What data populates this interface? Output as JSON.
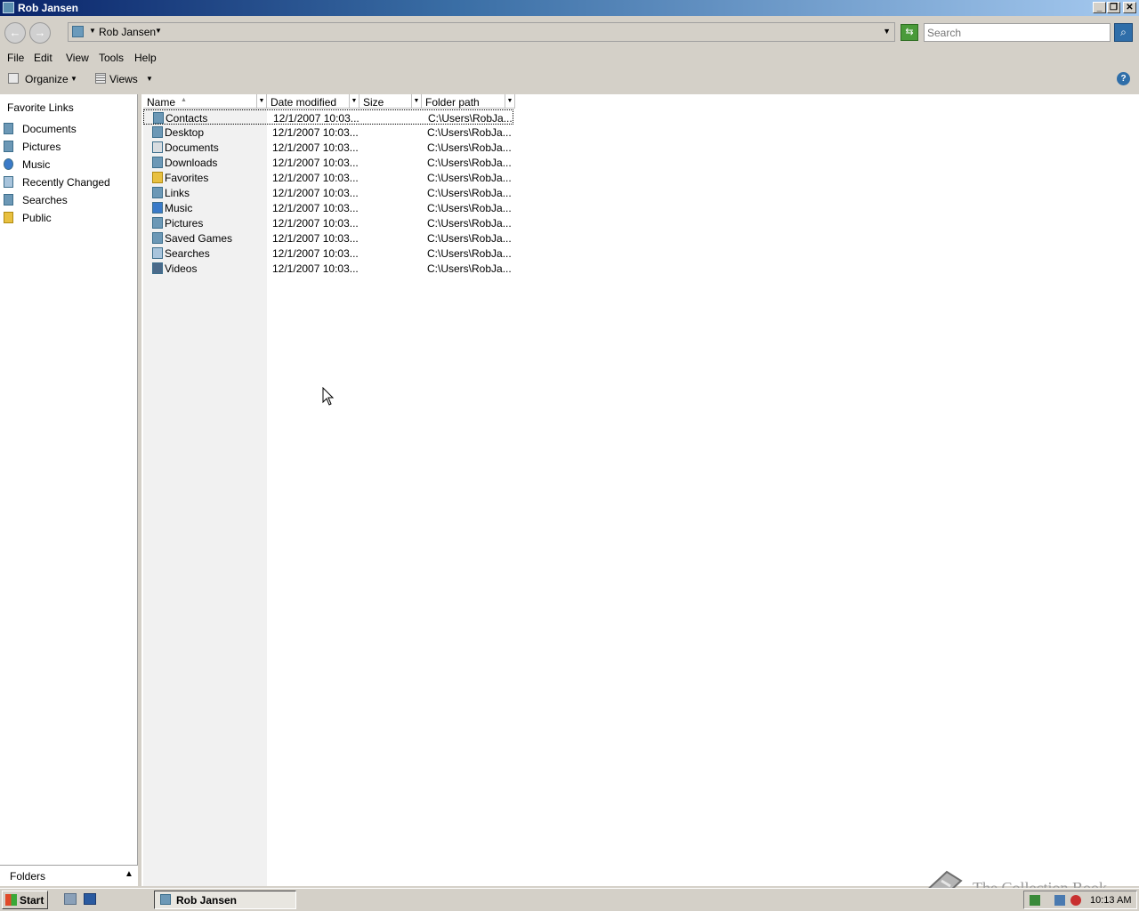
{
  "window": {
    "title": "Rob Jansen"
  },
  "address": {
    "crumb": "Rob Jansen"
  },
  "search": {
    "placeholder": "Search"
  },
  "menu": {
    "file": "File",
    "edit": "Edit",
    "view": "View",
    "tools": "Tools",
    "help": "Help"
  },
  "toolbar": {
    "organize": "Organize",
    "views": "Views"
  },
  "nav": {
    "title": "Favorite Links",
    "links": [
      "Documents",
      "Pictures",
      "Music",
      "Recently Changed",
      "Searches",
      "Public"
    ],
    "folders_label": "Folders"
  },
  "columns": {
    "name": "Name",
    "date": "Date modified",
    "size": "Size",
    "path": "Folder path"
  },
  "files": [
    {
      "name": "Contacts",
      "date": "12/1/2007 10:03...",
      "path": "C:\\Users\\RobJa..."
    },
    {
      "name": "Desktop",
      "date": "12/1/2007 10:03...",
      "path": "C:\\Users\\RobJa..."
    },
    {
      "name": "Documents",
      "date": "12/1/2007 10:03...",
      "path": "C:\\Users\\RobJa..."
    },
    {
      "name": "Downloads",
      "date": "12/1/2007 10:03...",
      "path": "C:\\Users\\RobJa..."
    },
    {
      "name": "Favorites",
      "date": "12/1/2007 10:03...",
      "path": "C:\\Users\\RobJa..."
    },
    {
      "name": "Links",
      "date": "12/1/2007 10:03...",
      "path": "C:\\Users\\RobJa..."
    },
    {
      "name": "Music",
      "date": "12/1/2007 10:03...",
      "path": "C:\\Users\\RobJa..."
    },
    {
      "name": "Pictures",
      "date": "12/1/2007 10:03...",
      "path": "C:\\Users\\RobJa..."
    },
    {
      "name": "Saved Games",
      "date": "12/1/2007 10:03...",
      "path": "C:\\Users\\RobJa..."
    },
    {
      "name": "Searches",
      "date": "12/1/2007 10:03...",
      "path": "C:\\Users\\RobJa..."
    },
    {
      "name": "Videos",
      "date": "12/1/2007 10:03...",
      "path": "C:\\Users\\RobJa..."
    }
  ],
  "watermark": "The Collection Book",
  "taskbar": {
    "start": "Start",
    "window": "Rob Jansen",
    "clock": "10:13 AM"
  }
}
